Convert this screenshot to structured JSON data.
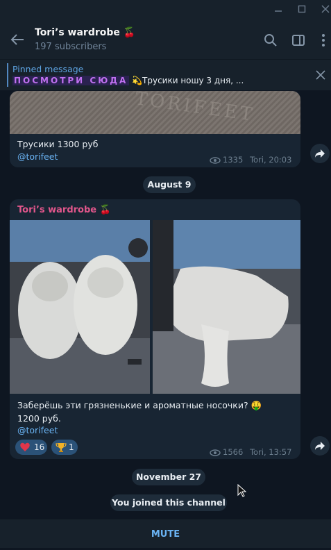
{
  "window": {
    "controls": [
      "minimize",
      "maximize",
      "close"
    ]
  },
  "header": {
    "title": "Tori’s wardrobe 🍒",
    "subtitle": "197 subscribers",
    "icons": [
      "back-arrow-icon",
      "search-icon",
      "sidebar-toggle-icon",
      "more-vertical-icon"
    ]
  },
  "pinned": {
    "label": "Pinned message",
    "fancy_text": "ПОСМОТРИ СЮДА",
    "text": " 💫Трусики ношу 3 дня, ..."
  },
  "messages": [
    {
      "text": "Трусики 1300 руб",
      "link": "@torifeet",
      "views": "1335",
      "meta": "Tori, 20:03",
      "photo_watermark": "TORIFEET"
    },
    {
      "author": "Tori’s wardrobe 🍒",
      "text_line1": "Заберёшь эти грязненькие и ароматные носочки? 🤑",
      "text_line2": "1200 руб.",
      "link": "@torifeet",
      "reactions": [
        {
          "emoji": "❤️‍🔥",
          "count": "16"
        },
        {
          "emoji": "🏆",
          "count": "1"
        }
      ],
      "views": "1566",
      "meta": "Tori, 13:57"
    }
  ],
  "date_pills": {
    "aug": "August 9",
    "nov": "November 27"
  },
  "service": {
    "joined": "You joined this channel"
  },
  "footer": {
    "mute_label": "MUTE"
  },
  "colors": {
    "background": "#0e1621",
    "panel": "#17212b",
    "bubble": "#182533",
    "accent": "#6ab3f3",
    "author": "#e1568b"
  }
}
